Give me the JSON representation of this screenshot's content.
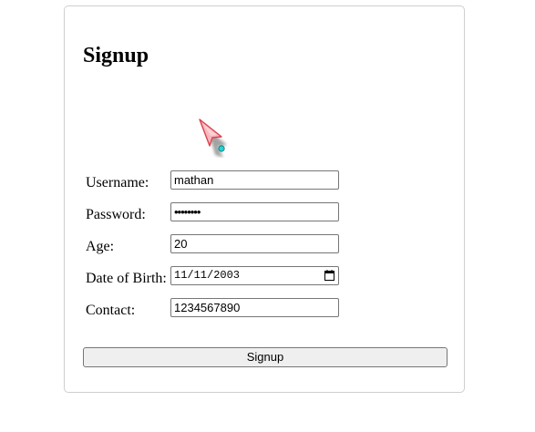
{
  "form": {
    "title": "Signup",
    "fields": [
      {
        "label": "Username:",
        "value": "mathan"
      },
      {
        "label": "Password:",
        "value": "••••••••"
      },
      {
        "label": "Age:",
        "value": "20"
      },
      {
        "label": "Date of Birth:",
        "value": "11/11/2003"
      },
      {
        "label": "Contact:",
        "value": "1234567890"
      }
    ],
    "submit_label": "Signup"
  },
  "icons": {
    "cursor": "mouse-pointer-icon",
    "calendar": "calendar-icon"
  }
}
